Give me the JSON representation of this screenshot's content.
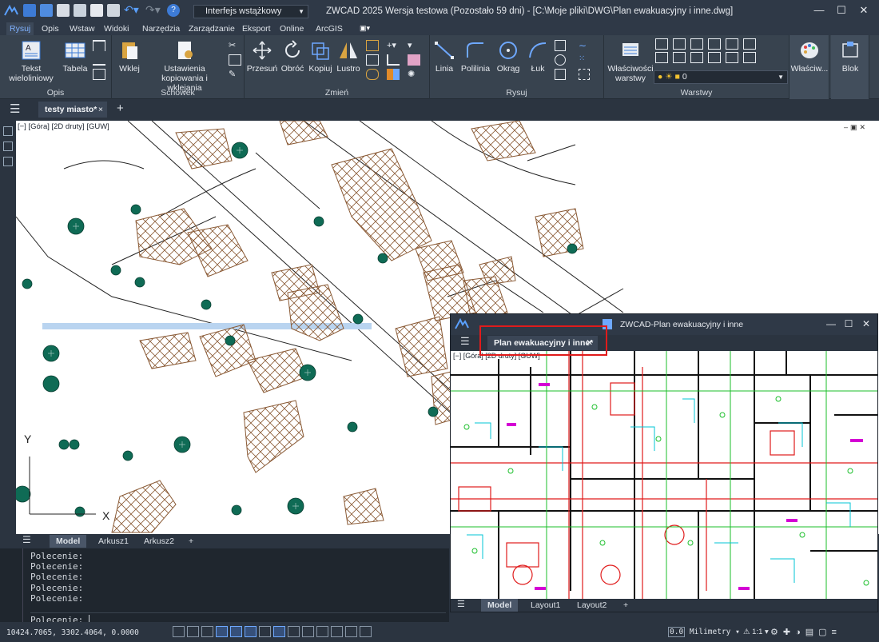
{
  "titlebar": {
    "workspace": "Interfejs wstążkowy",
    "title": "ZWCAD 2025 Wersja testowa (Pozostało 59 dni) - [C:\\Moje pliki\\DWG\\Plan ewakuacyjny i inne.dwg]"
  },
  "menu": [
    "Rysuj",
    "Opis",
    "Wstaw",
    "Widoki",
    "Narzędzia",
    "Zarządzanie",
    "Eksport",
    "Online",
    "ArcGIS"
  ],
  "ribbon": {
    "opis": {
      "tekst": "Tekst",
      "tekst2": "wieloliniowy",
      "tabela": "Tabela",
      "label": "Opis"
    },
    "schowek": {
      "wklej": "Wklej",
      "ustawienia": "Ustawienia",
      "ustawienia2": "kopiowania i wklejania",
      "label": "Schowek"
    },
    "zmien": {
      "przesun": "Przesuń",
      "obroc": "Obróć",
      "kopiuj": "Kopiuj",
      "lustro": "Lustro",
      "label": "Zmień"
    },
    "rysuj": {
      "linia": "Linia",
      "polilinia": "Polilinia",
      "okrag": "Okrąg",
      "luk": "Łuk",
      "label": "Rysuj"
    },
    "warstwy": {
      "wlasciwosci": "Właściwości",
      "wlasciwosci2": "warstwy",
      "current_layer": "0",
      "label": "Warstwy"
    },
    "wlasciw": "Właściw...",
    "blok": "Blok"
  },
  "doctab": {
    "name": "testy miasto*",
    "close": "×",
    "add": "+"
  },
  "viewport_label": "[−] [Góra] [2D druty] [GUW]",
  "axis": {
    "y": "Y",
    "x": "X"
  },
  "layout_tabs": [
    "Model",
    "Arkusz1",
    "Arkusz2"
  ],
  "command": {
    "history": [
      "Polecenie:",
      "Polecenie:",
      "Polecenie:",
      "Polecenie:",
      "Polecenie:"
    ],
    "prompt": "Polecenie:"
  },
  "status": {
    "coords": "10424.7065, 3302.4064, 0.0000",
    "units": "Milimetry",
    "scale": "1:1"
  },
  "float_window": {
    "title": "ZWCAD-Plan ewakuacyjny i inne",
    "tab": "Plan ewakuacyjny i inne*",
    "viewport_label": "[−] [Góra] [2D druty] [GUW]",
    "layout_tabs": [
      "Model",
      "Layout1",
      "Layout2"
    ]
  },
  "colors": {
    "accent": "#7fb2ff",
    "tree_fill": "#0f6b55",
    "hatch": "#8a5a35",
    "highlight": "#e01b1b"
  }
}
